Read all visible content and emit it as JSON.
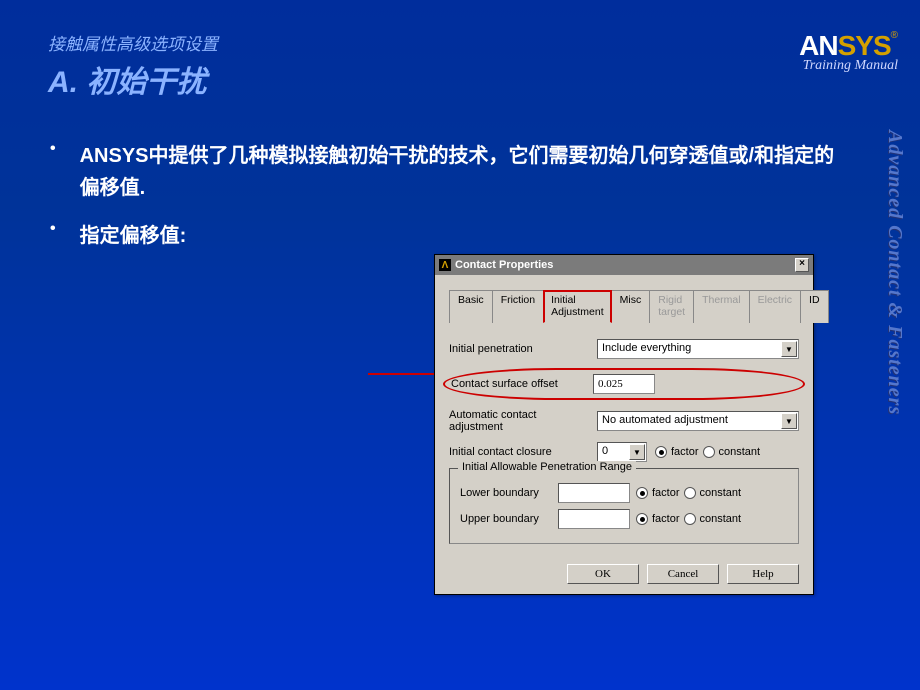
{
  "slide": {
    "pretitle": "接触属性高级选项设置",
    "title": "A. 初始干扰"
  },
  "logo": {
    "an": "AN",
    "sys": "SYS",
    "sub": "Training Manual"
  },
  "side_text": "Advanced Contact & Fasteners",
  "bullets": [
    "ANSYS中提供了几种模拟接触初始干扰的技术，它们需要初始几何穿透值或/和指定的偏移值.",
    "指定偏移值:"
  ],
  "dialog": {
    "title": "Contact Properties",
    "tabs": {
      "basic": "Basic",
      "friction": "Friction",
      "initial": "Initial Adjustment",
      "misc": "Misc",
      "rigid": "Rigid target",
      "thermal": "Thermal",
      "electric": "Electric",
      "id": "ID"
    },
    "fields": {
      "initial_penetration_label": "Initial penetration",
      "initial_penetration_value": "Include everything",
      "contact_offset_label": "Contact surface offset",
      "contact_offset_value": "0.025",
      "auto_adjust_label": "Automatic contact adjustment",
      "auto_adjust_value": "No automated adjustment",
      "closure_label": "Initial contact closure",
      "closure_value": "0",
      "factor": "factor",
      "constant": "constant"
    },
    "fieldset": {
      "legend": "Initial Allowable Penetration Range",
      "lower_label": "Lower boundary",
      "upper_label": "Upper boundary"
    },
    "buttons": {
      "ok": "OK",
      "cancel": "Cancel",
      "help": "Help"
    }
  }
}
